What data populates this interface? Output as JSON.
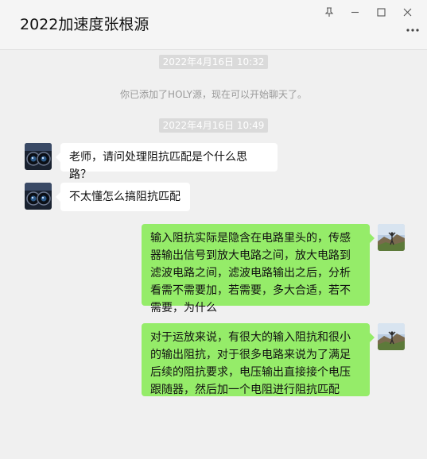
{
  "window": {
    "title": "2022加速度张根源",
    "controls": [
      {
        "name": "pin-icon"
      },
      {
        "name": "minimize-icon"
      },
      {
        "name": "maximize-icon"
      },
      {
        "name": "close-icon"
      }
    ],
    "more_icon": "more-dots-icon"
  },
  "messages": [
    {
      "type": "timestamp",
      "text": "2022年4月16日 10:32"
    },
    {
      "type": "system",
      "text": "你已添加了HOLY源，现在可以开始聊天了。"
    },
    {
      "type": "timestamp",
      "text": "2022年4月16日 10:49"
    },
    {
      "type": "incoming",
      "text": "老师，请问处理阻抗匹配是个什么思路？"
    },
    {
      "type": "incoming",
      "text": "不太懂怎么搞阻抗匹配"
    },
    {
      "type": "outgoing",
      "text": "输入阻抗实际是隐含在电路里头的，传感器输出信号到放大电路之间，放大电路到滤波电路之间，滤波电路输出之后，分析看需不需要加，若需要，多大合适，若不需要，为什么"
    },
    {
      "type": "outgoing",
      "text": "对于运放来说，有很大的输入阻抗和很小的输出阻抗，对于很多电路来说为了满足后续的阻抗要求，电压输出直接接个电压跟随器，然后加一个电阻进行阻抗匹配"
    }
  ],
  "colors": {
    "outgoing_bubble": "#95ec69",
    "incoming_bubble": "#ffffff",
    "background": "#f0f0f0",
    "timestamp_bg": "#dadada"
  }
}
